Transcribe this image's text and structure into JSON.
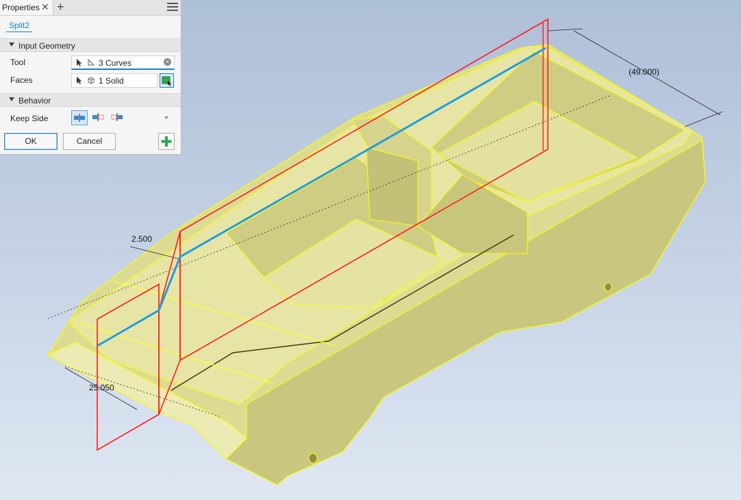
{
  "panel": {
    "tab_title": "Properties",
    "close_glyph": "✕",
    "add_glyph": "+",
    "feature_name": "Split2",
    "sections": {
      "input_geometry": "Input Geometry",
      "behavior": "Behavior"
    },
    "tool": {
      "label": "Tool",
      "value": "3 Curves"
    },
    "faces": {
      "label": "Faces",
      "value": "1 Solid"
    },
    "keep_side": {
      "label": "Keep Side"
    },
    "buttons": {
      "ok": "OK",
      "cancel": "Cancel"
    }
  },
  "viewport": {
    "dimensions": {
      "width_dim": "(49.000)",
      "offset_dim": "2.500",
      "length_dim": "25.050"
    }
  },
  "colors": {
    "model_fill": "#dcdb94",
    "edge_highlight": "#ffff00",
    "split_plane": "#ff1a1a",
    "split_curve": "#1e9be0",
    "accent": "#1a7fc4"
  }
}
